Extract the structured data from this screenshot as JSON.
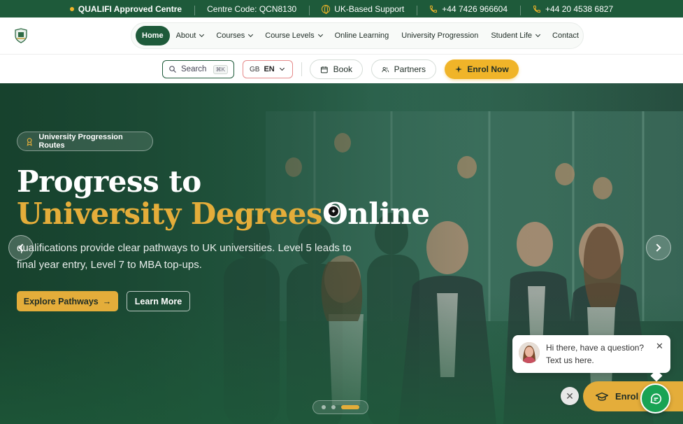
{
  "topbar": {
    "approved": "QUALIFI Approved Centre",
    "centre_code": "Centre Code: QCN8130",
    "support": "UK-Based Support",
    "phone1": "+44 7426 966604",
    "phone2": "+44 20 4538 6827"
  },
  "nav": {
    "items": [
      {
        "label": "Home",
        "active": true
      },
      {
        "label": "About",
        "dropdown": true
      },
      {
        "label": "Courses",
        "dropdown": true
      },
      {
        "label": "Course Levels",
        "dropdown": true
      },
      {
        "label": "Online Learning"
      },
      {
        "label": "University Progression"
      },
      {
        "label": "Student Life",
        "dropdown": true
      },
      {
        "label": "Contact"
      }
    ]
  },
  "actions": {
    "search_label": "Search",
    "search_kbd": "⌘K",
    "lang_flag": "GB",
    "lang_code": "EN",
    "book": "Book",
    "partners": "Partners",
    "enrol": "Enrol Now"
  },
  "hero": {
    "badge": "University Progression Routes",
    "title_line1": "Progress to",
    "title_line2_gold": "University Degrees",
    "title_line2_white": "Online",
    "description": "qualifications provide clear pathways to UK universities. Level 5 leads to final year entry, Level 7 to MBA top-ups.",
    "cta_primary": "Explore Pathways",
    "cta_secondary": "Learn More",
    "slide_count": 3,
    "active_slide": 3
  },
  "chat": {
    "greeting_line1": "Hi there, have a question?",
    "greeting_line2": "Text us here.",
    "enrol_float": "Enrol N"
  },
  "colors": {
    "brand_green": "#1e5a3a",
    "gold": "#e4ad3a",
    "chat_green": "#19a354"
  }
}
